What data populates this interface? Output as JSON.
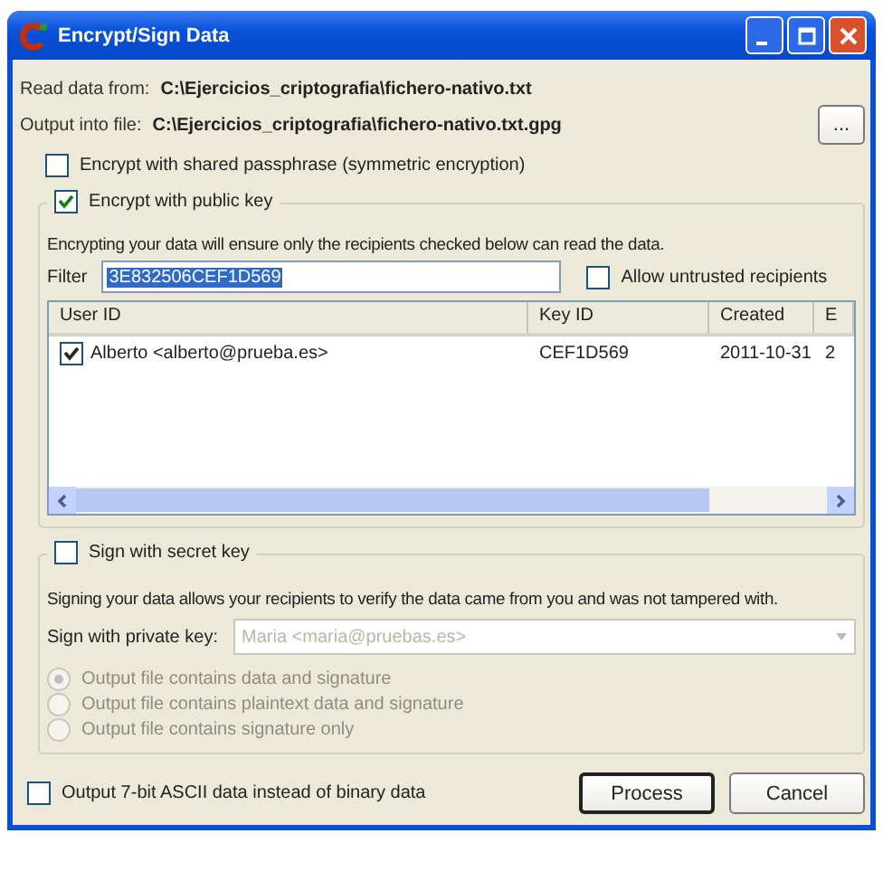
{
  "window": {
    "title": "Encrypt/Sign Data"
  },
  "read_data_from": {
    "label": "Read data from:",
    "value": "C:\\Ejercicios_criptografia\\fichero-nativo.txt"
  },
  "output_into_file": {
    "label": "Output into file:",
    "value": "C:\\Ejercicios_criptografia\\fichero-nativo.txt.gpg"
  },
  "browse_button": "...",
  "symmetric": {
    "label": "Encrypt with shared passphrase (symmetric encryption)",
    "checked": false
  },
  "public_key": {
    "label": "Encrypt with public key",
    "checked": true,
    "description": "Encrypting your data will ensure only the recipients checked below can read the data.",
    "filter": {
      "label": "Filter",
      "value": "3E832506CEF1D569"
    },
    "allow_untrusted": {
      "label": "Allow untrusted recipients",
      "checked": false
    },
    "table": {
      "columns": [
        "User ID",
        "Key ID",
        "Created",
        "E"
      ],
      "rows": [
        {
          "checked": true,
          "cells": [
            "Alberto <alberto@prueba.es>",
            "CEF1D569",
            "2011-10-31",
            "2"
          ]
        }
      ]
    }
  },
  "sign": {
    "label": "Sign with secret key",
    "checked": false,
    "description": "Signing your data allows your recipients to verify the data came from you and was not tampered with.",
    "private_key": {
      "label": "Sign with private key:",
      "value": "Maria <maria@pruebas.es>",
      "disabled": true
    },
    "options": [
      {
        "label": "Output file contains data and signature",
        "selected": true,
        "disabled": true
      },
      {
        "label": "Output file contains plaintext data and signature",
        "selected": false,
        "disabled": true
      },
      {
        "label": "Output file contains signature only",
        "selected": false,
        "disabled": true
      }
    ]
  },
  "ascii": {
    "label": "Output 7-bit ASCII data instead of binary data",
    "checked": false
  },
  "buttons": [
    "Process",
    "Cancel"
  ]
}
